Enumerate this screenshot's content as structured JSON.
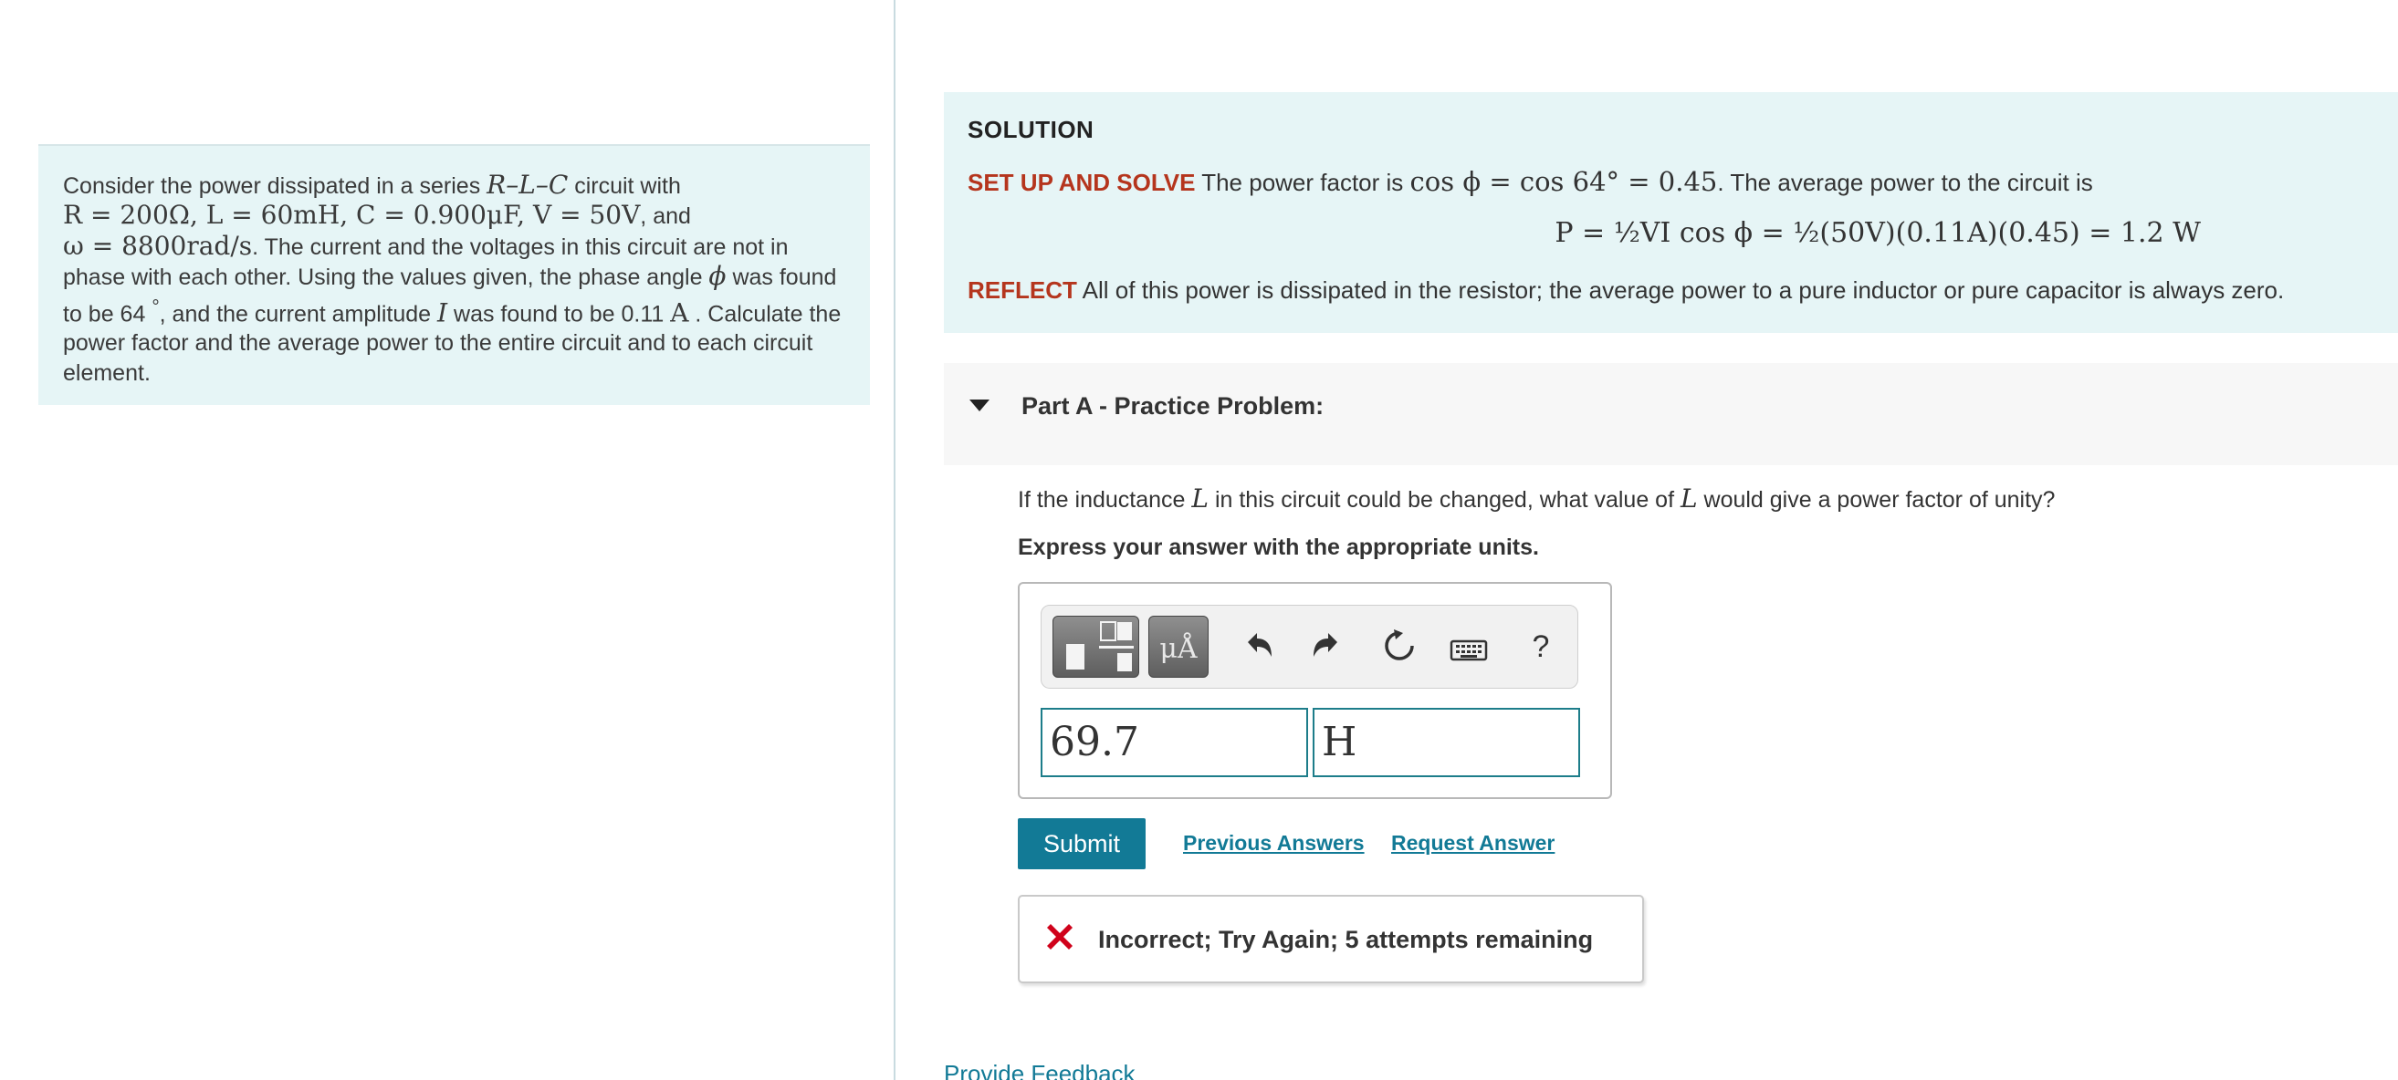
{
  "problem": {
    "t1": "Consider the power dissipated in a series ",
    "rlc": "R–L–C",
    "t2": " circuit with",
    "vals": "R = 200Ω, L = 60mH, C = 0.900μF, V = 50V",
    "t3": ", and",
    "omega": "ω = 8800rad/s",
    "t4": ". The current and the voltages in this circuit are not in phase with each other. Using the values given, the phase angle ",
    "phi": "ϕ",
    "t5": " was found to be 64 ",
    "deg": "°",
    "t6": ", and the current amplitude ",
    "I": "I",
    "t7": " was found to be 0.11 ",
    "A": "A",
    "t8": " . Calculate the power factor and the average power to the entire circuit and to each circuit element."
  },
  "solution": {
    "title": "SOLUTION",
    "setup_kw": "SET UP AND SOLVE",
    "setup_t1": " The power factor is ",
    "setup_math": "cos ϕ = cos 64° = 0.45",
    "setup_t2": ". The average power to the circuit is",
    "equation": "P = ½VI cos ϕ = ½(50V)(0.11A)(0.45) = 1.2 W",
    "reflect_kw": "REFLECT",
    "reflect_text": " All of this power is dissipated in the resistor; the average power to a pure inductor or pure capacitor is always zero."
  },
  "partA": {
    "title": "Part A - Practice Problem:",
    "q1": "If the inductance ",
    "qL": "L",
    "q2": " in this circuit could be changed, what value of ",
    "qL2": "L",
    "q3": " would give a power factor of unity?",
    "express": "Express your answer with the appropriate units.",
    "toolbar": {
      "units_label": "μÅ",
      "help_label": "?"
    },
    "answer_value": "69.7",
    "answer_unit": "H",
    "submit_label": "Submit",
    "previous_answers": "Previous Answers",
    "request_answer": "Request Answer",
    "feedback": "Incorrect; Try Again; 5 attempts remaining"
  },
  "footer": {
    "provide_feedback": "Provide Feedback"
  },
  "colors": {
    "accent": "#127a96",
    "keyword": "#b5351d",
    "panel": "#e6f5f6",
    "error": "#d0021b"
  }
}
